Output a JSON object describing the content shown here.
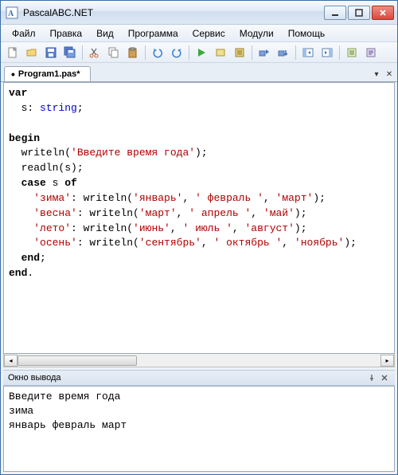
{
  "window": {
    "title": "PascalABC.NET"
  },
  "menu": {
    "file": "Файл",
    "edit": "Правка",
    "view": "Вид",
    "program": "Программа",
    "service": "Сервис",
    "modules": "Модули",
    "help": "Помощь"
  },
  "tab": {
    "name": "Program1.pas*",
    "modified_marker": "•"
  },
  "code": {
    "l1a": "var",
    "l2a": "  s: ",
    "l2b": "string",
    "l2c": ";",
    "l3": "",
    "l4a": "begin",
    "l5a": "  writeln(",
    "l5b": "'Введите время года'",
    "l5c": ");",
    "l6a": "  readln(s);",
    "l7a": "  ",
    "l7b": "case",
    "l7c": " s ",
    "l7d": "of",
    "l8a": "    ",
    "l8b": "'зима'",
    "l8c": ": writeln(",
    "l8d": "'январь'",
    "l8e": ", ",
    "l8f": "' февраль '",
    "l8g": ", ",
    "l8h": "'март'",
    "l8i": ");",
    "l9a": "    ",
    "l9b": "'весна'",
    "l9c": ": writeln(",
    "l9d": "'март'",
    "l9e": ", ",
    "l9f": "' апрель '",
    "l9g": ", ",
    "l9h": "'май'",
    "l9i": ");",
    "l10a": "    ",
    "l10b": "'лето'",
    "l10c": ": writeln(",
    "l10d": "'июнь'",
    "l10e": ", ",
    "l10f": "' июль '",
    "l10g": ", ",
    "l10h": "'август'",
    "l10i": ");",
    "l11a": "    ",
    "l11b": "'осень'",
    "l11c": ": writeln(",
    "l11d": "'сентябрь'",
    "l11e": ", ",
    "l11f": "' октябрь '",
    "l11g": ", ",
    "l11h": "'ноябрь'",
    "l11i": ");",
    "l12a": "  ",
    "l12b": "end",
    "l12c": ";",
    "l13a": "end",
    "l13b": "."
  },
  "output": {
    "title": "Окно вывода",
    "lines": "Введите время года\nзима\nянварь февраль март"
  }
}
